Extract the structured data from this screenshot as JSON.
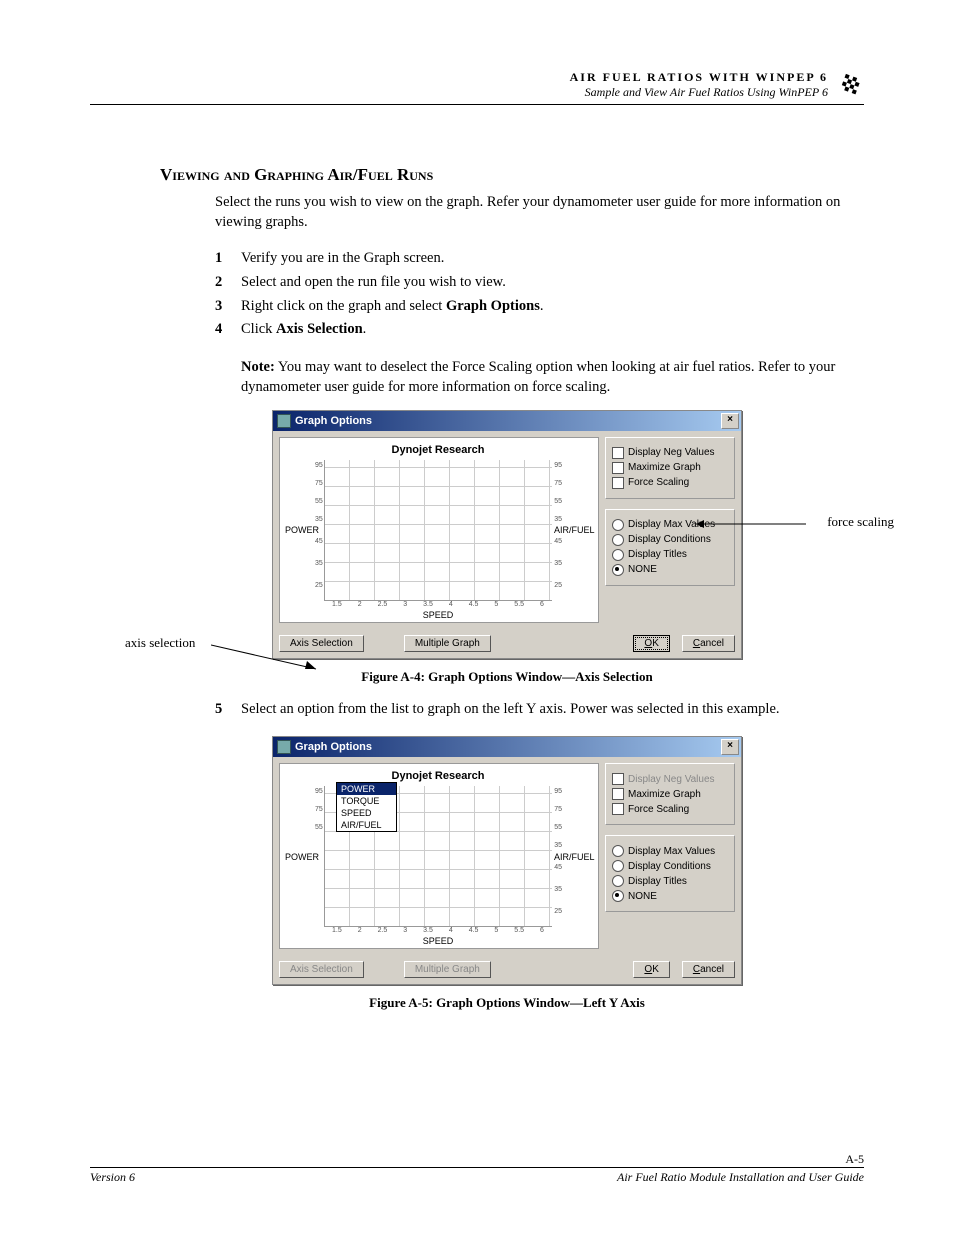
{
  "header": {
    "chapter": "AIR FUEL RATIOS WITH WINPEP 6",
    "subtitle": "Sample and View Air Fuel Ratios Using WinPEP 6"
  },
  "section_title": "Viewing and Graphing Air/Fuel Runs",
  "intro": "Select the runs you wish to view on the graph. Refer your dynamometer user guide for more information on viewing graphs.",
  "steps": {
    "s1": "Verify you are in the Graph screen.",
    "s2": "Select and open the run file you wish to view.",
    "s3_pre": "Right click on the graph and select ",
    "s3_bold": "Graph Options",
    "s3_post": ".",
    "s4_pre": "Click ",
    "s4_bold": "Axis Selection",
    "s4_post": ".",
    "note_label": "Note:",
    "note_body": " You may want to deselect the Force Scaling option when looking at air fuel ratios. Refer to your dynamometer user guide for more information on force scaling.",
    "s5": "Select an option from the list to graph on the left Y axis. Power was selected in this example."
  },
  "dialog": {
    "title": "Graph Options",
    "graph_title": "Dynojet Research",
    "left_y": "POWER",
    "right_y": "AIR/FUEL",
    "x_label": "SPEED",
    "ticks": [
      "1.5",
      "2",
      "2.5",
      "3",
      "3.5",
      "4",
      "4.5",
      "5",
      "5.5",
      "6"
    ],
    "checks": {
      "neg": "Display Neg Values",
      "max": "Maximize Graph",
      "force": "Force Scaling"
    },
    "radios": {
      "maxv": "Display Max Values",
      "cond": "Display Conditions",
      "titles": "Display Titles",
      "none": "NONE"
    },
    "axis_btn": "Axis Selection",
    "multi_btn": "Multiple Graph",
    "ok": "OK",
    "cancel": "Cancel"
  },
  "dropdown": {
    "power": "POWER",
    "torque": "TORQUE",
    "speed": "SPEED",
    "af": "AIR/FUEL"
  },
  "callouts": {
    "force": "force scaling",
    "axis": "axis selection"
  },
  "captions": {
    "fig_a4": "Figure A-4: Graph Options Window—Axis Selection",
    "fig_a5": "Figure A-5: Graph Options Window—Left Y Axis"
  },
  "footer": {
    "version": "Version 6",
    "guide": "Air Fuel Ratio Module Installation and User Guide",
    "page": "A-5"
  }
}
